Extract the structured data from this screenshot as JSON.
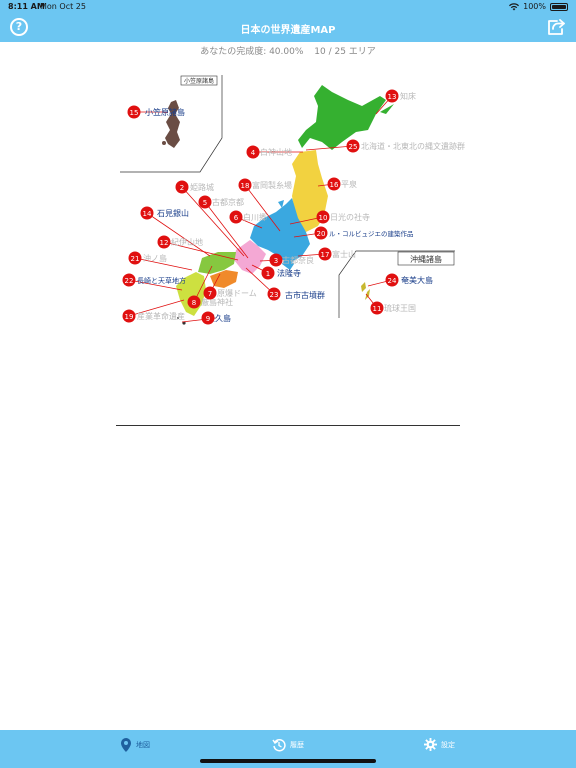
{
  "status": {
    "time": "8:11 AM",
    "date": "Mon Oct 25",
    "battery": "100%"
  },
  "nav": {
    "title": "日本の世界遺産MAP"
  },
  "progress": {
    "completion": "あなたの完成度: 40.00%",
    "areas": "10 / 25 エリア"
  },
  "inset_labels": {
    "ogasawara": "小笠原諸島",
    "okinawa": "沖縄諸島"
  },
  "sites": [
    {
      "n": "1",
      "name": "法隆寺",
      "visited": true
    },
    {
      "n": "2",
      "name": "姫路城",
      "visited": false
    },
    {
      "n": "3",
      "name": "古都奈良",
      "visited": false
    },
    {
      "n": "4",
      "name": "白神山地",
      "visited": false
    },
    {
      "n": "5",
      "name": "古都京都",
      "visited": false
    },
    {
      "n": "6",
      "name": "白川郷",
      "visited": false
    },
    {
      "n": "7",
      "name": "原爆ドーム",
      "visited": false
    },
    {
      "n": "8",
      "name": "厳島神社",
      "visited": false
    },
    {
      "n": "9",
      "name": "屋久島",
      "visited": true
    },
    {
      "n": "10",
      "name": "日光の社寺",
      "visited": false
    },
    {
      "n": "11",
      "name": "琉球王国",
      "visited": false
    },
    {
      "n": "12",
      "name": "紀伊山地",
      "visited": false
    },
    {
      "n": "13",
      "name": "知床",
      "visited": false
    },
    {
      "n": "14",
      "name": "石見銀山",
      "visited": true
    },
    {
      "n": "15",
      "name": "小笠原諸島",
      "visited": true
    },
    {
      "n": "16",
      "name": "平泉",
      "visited": false
    },
    {
      "n": "17",
      "name": "富士山",
      "visited": false
    },
    {
      "n": "18",
      "name": "富岡製糸場",
      "visited": false
    },
    {
      "n": "19",
      "name": "産業革命遺産",
      "visited": false
    },
    {
      "n": "20",
      "name": "ル・コルビュジエの建築作品",
      "visited": true
    },
    {
      "n": "21",
      "name": "沖ノ島",
      "visited": false
    },
    {
      "n": "22",
      "name": "長崎と天草地方",
      "visited": true
    },
    {
      "n": "23",
      "name": "古市古墳群",
      "visited": true
    },
    {
      "n": "24",
      "name": "奄美大島",
      "visited": true
    },
    {
      "n": "25",
      "name": "北海道・北東北の縄文遺跡群",
      "visited": true
    }
  ],
  "tabs": [
    {
      "label": "地図",
      "icon": "map-pin-icon"
    },
    {
      "label": "履歴",
      "icon": "history-icon"
    },
    {
      "label": "設定",
      "icon": "gear-icon"
    }
  ],
  "colors": {
    "accent": "#6cc6f2",
    "marker": "#e01010",
    "visited_text": "#1a3e8a",
    "unvisited_text": "#b8b8b8"
  }
}
